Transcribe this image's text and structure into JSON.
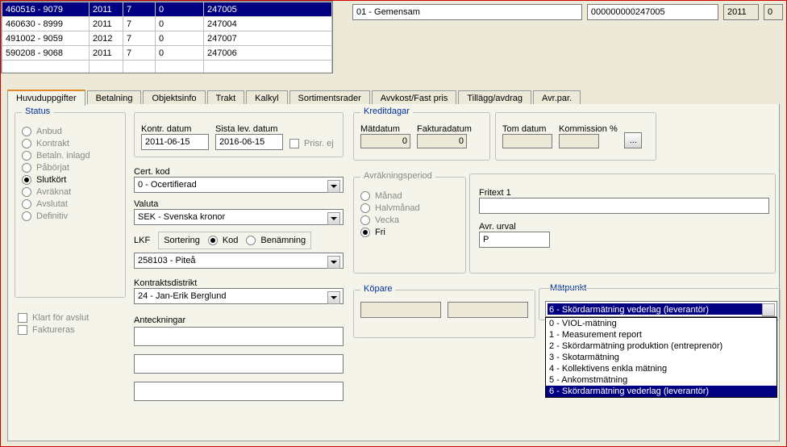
{
  "grid": {
    "rows": [
      [
        "460516 - 9079",
        "2011",
        "7",
        "0",
        "247005"
      ],
      [
        "460630 - 8999",
        "2011",
        "7",
        "0",
        "247004"
      ],
      [
        "491002 - 9059",
        "2012",
        "7",
        "0",
        "247007"
      ],
      [
        "590208 - 9068",
        "2011",
        "7",
        "0",
        "247006"
      ],
      [
        "",
        "",
        "",
        "",
        ""
      ]
    ],
    "selectedIndex": 0
  },
  "top": {
    "type": "01 - Gemensam",
    "number": "000000000247005",
    "year": "2011",
    "zero": "0"
  },
  "tabs": [
    "Huvuduppgifter",
    "Betalning",
    "Objektsinfo",
    "Trakt",
    "Kalkyl",
    "Sortimentsrader",
    "Avvkost/Fast pris",
    "Tillägg/avdrag",
    "Avr.par."
  ],
  "status": {
    "legend": "Status",
    "options": [
      "Anbud",
      "Kontrakt",
      "Betaln. inlagd",
      "Påbörjat",
      "Slutkört",
      "Avräknat",
      "Avslutat",
      "Definitiv"
    ],
    "selected": "Slutkört",
    "klart_label": "Klart för avslut",
    "faktureras_label": "Faktureras"
  },
  "dates": {
    "kontr_label": "Kontr. datum",
    "sista_label": "Sista lev. datum",
    "kontr": "2011-06-15",
    "sista": "2016-06-15",
    "prisr_label": "Prisr. ej"
  },
  "cert": {
    "label": "Cert. kod",
    "value": "0 - Ocertifierad"
  },
  "valuta": {
    "label": "Valuta",
    "value": "SEK - Svenska kronor"
  },
  "lkf": {
    "label": "LKF",
    "sort_label": "Sortering",
    "kod_label": "Kod",
    "ben_label": "Benämning",
    "value": "258103 - Piteå"
  },
  "kd": {
    "label": "Kontraktsdistrikt",
    "value": "24 - Jan-Erik Berglund"
  },
  "notes_label": "Anteckningar",
  "kredit": {
    "legend": "Kreditdagar",
    "mat_label": "Mätdatum",
    "fak_label": "Fakturadatum",
    "mat": "0",
    "fak": "0",
    "tom_label": "Tom datum",
    "komm_label": "Kommission %",
    "tom": "",
    "komm": "",
    "ellipsis": "..."
  },
  "avrp": {
    "legend": "Avräkningsperiod",
    "options": [
      "Månad",
      "Halvmånad",
      "Vecka",
      "Fri"
    ],
    "selected": "Fri"
  },
  "fritext": {
    "label": "Fritext 1",
    "value": ""
  },
  "avr_urval": {
    "label": "Avr. urval",
    "value": "P"
  },
  "kopare": {
    "legend": "Köpare",
    "a": "",
    "b": ""
  },
  "matpunkt": {
    "legend": "Mätpunkt",
    "selected": "6 - Skördarmätning vederlag (leverantör)",
    "options": [
      "0 - VIOL-mätning",
      "1 - Measurement report",
      "2 - Skördarmätning produktion (entreprenör)",
      "3 - Skotarmätning",
      "4 - Kollektivens enkla mätning",
      "5 - Ankomstmätning",
      "6 - Skördarmätning vederlag (leverantör)"
    ],
    "highlightIndex": 6
  }
}
